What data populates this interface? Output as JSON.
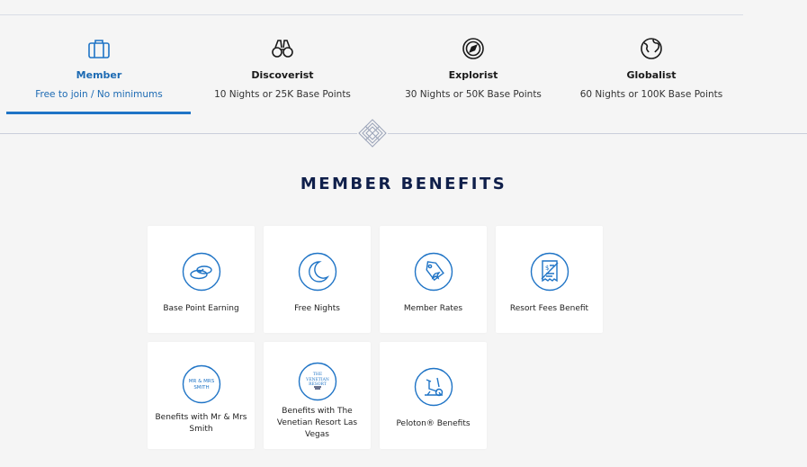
{
  "tiers": [
    {
      "name": "Member",
      "requirement": "Free to join / No minimums",
      "icon": "suitcase-icon",
      "active": true
    },
    {
      "name": "Discoverist",
      "requirement": "10 Nights or 25K Base Points",
      "icon": "binoculars-icon",
      "active": false
    },
    {
      "name": "Explorist",
      "requirement": "30 Nights or 50K Base Points",
      "icon": "compass-icon",
      "active": false
    },
    {
      "name": "Globalist",
      "requirement": "60 Nights or 100K Base Points",
      "icon": "globe-icon",
      "active": false
    }
  ],
  "section_title": "MEMBER BENEFITS",
  "benefits": [
    {
      "label": "Base Point Earning",
      "icon": "coins-icon"
    },
    {
      "label": "Free Nights",
      "icon": "moon-icon"
    },
    {
      "label": "Member Rates",
      "icon": "price-tag-icon"
    },
    {
      "label": "Resort Fees Benefit",
      "icon": "receipt-icon"
    },
    {
      "label": "Benefits with Mr & Mrs Smith",
      "icon": "mr-mrs-smith-logo-icon",
      "logo_text": "MR & MRS SMITH"
    },
    {
      "label": "Benefits with The Venetian Resort Las Vegas",
      "icon": "venetian-logo-icon",
      "logo_text": "THE VENETIAN RESORT"
    },
    {
      "label": "Peloton® Benefits",
      "icon": "peloton-bike-icon"
    }
  ],
  "colors": {
    "accent": "#1f74c6",
    "title": "#0f1f4a",
    "background": "#f5f5f5",
    "card": "#ffffff"
  }
}
